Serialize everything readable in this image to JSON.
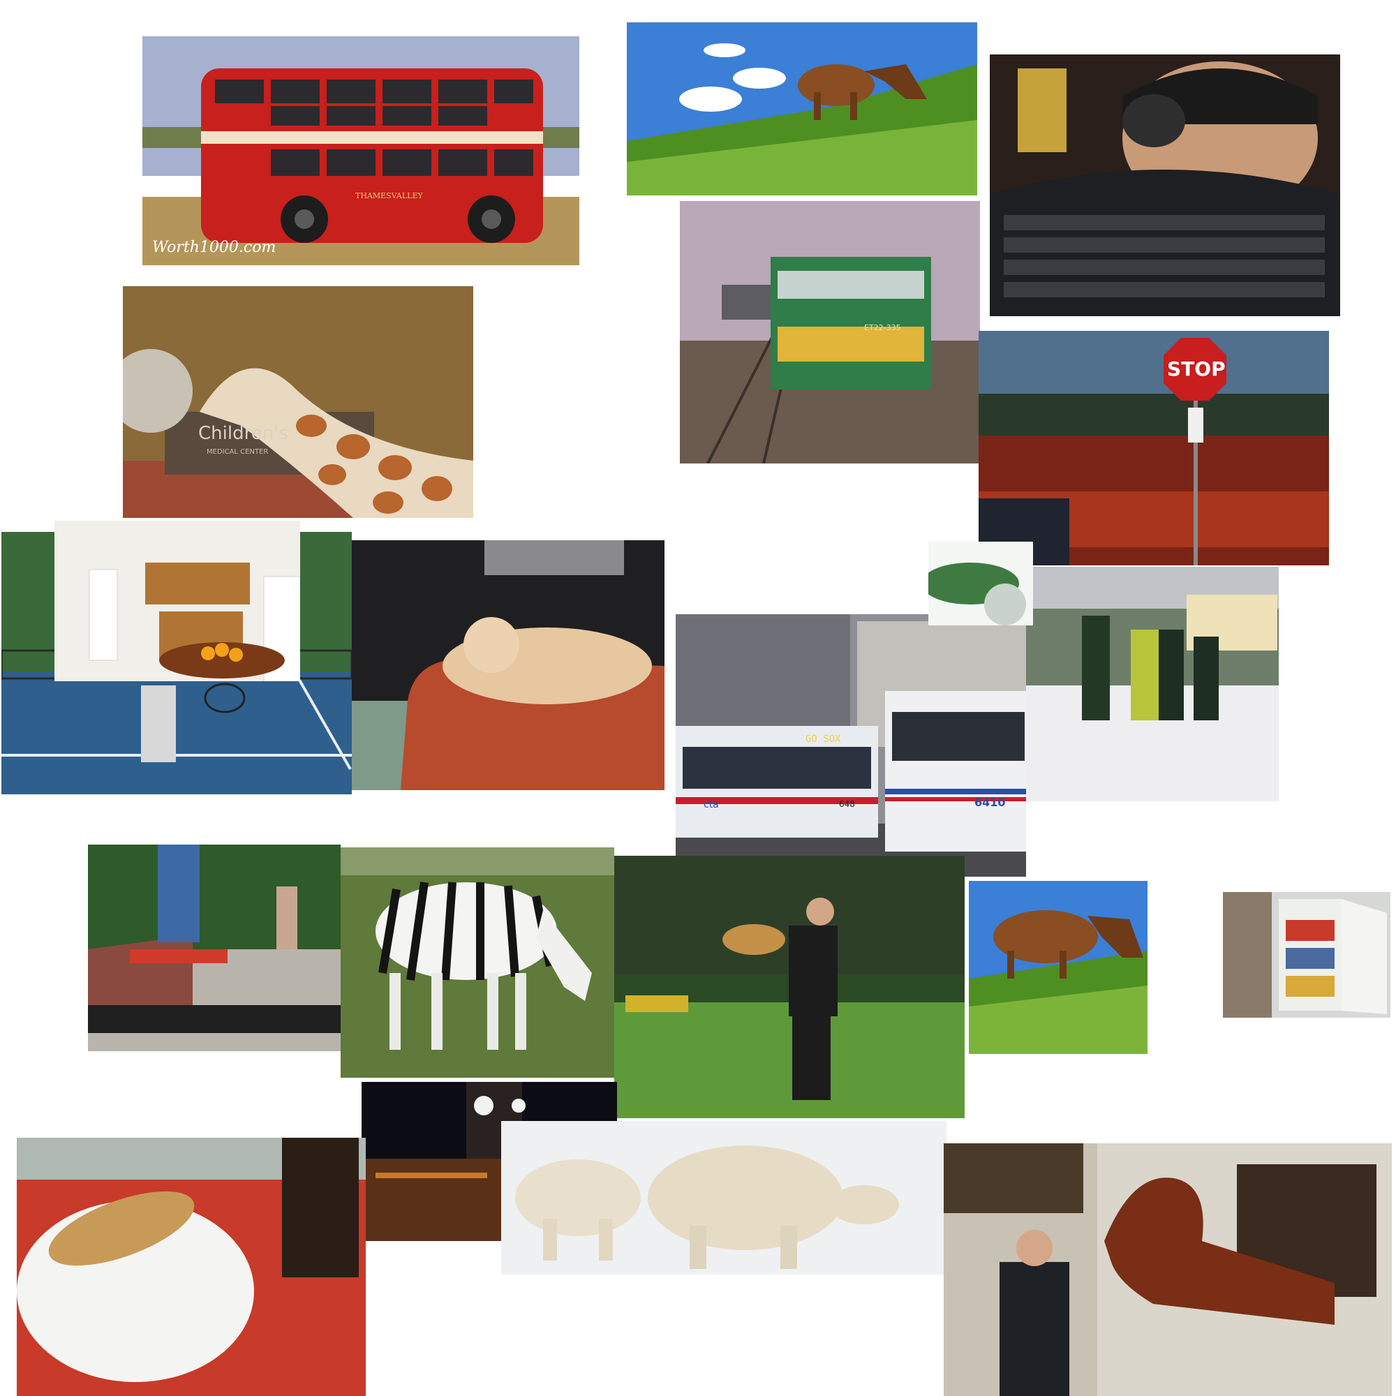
{
  "collage": {
    "bus": {
      "watermark": "Worth1000.com",
      "fleet_text": "THAMESVALLEY",
      "colors": {
        "body": "#c8201c",
        "cream": "#efe2c6",
        "sky": "#9aa6c8",
        "grass": "#b59a5b"
      }
    },
    "giraffe": {
      "sign_text": "Children's",
      "sign_sub": "MEDICAL CENTER"
    },
    "train": {
      "number": "ET22-335"
    },
    "stop_sign": {
      "text": "STOP"
    },
    "city_bus": {
      "dest": "GO SOX",
      "number_front": "648",
      "number_side": "6410",
      "brand": "cta"
    }
  }
}
